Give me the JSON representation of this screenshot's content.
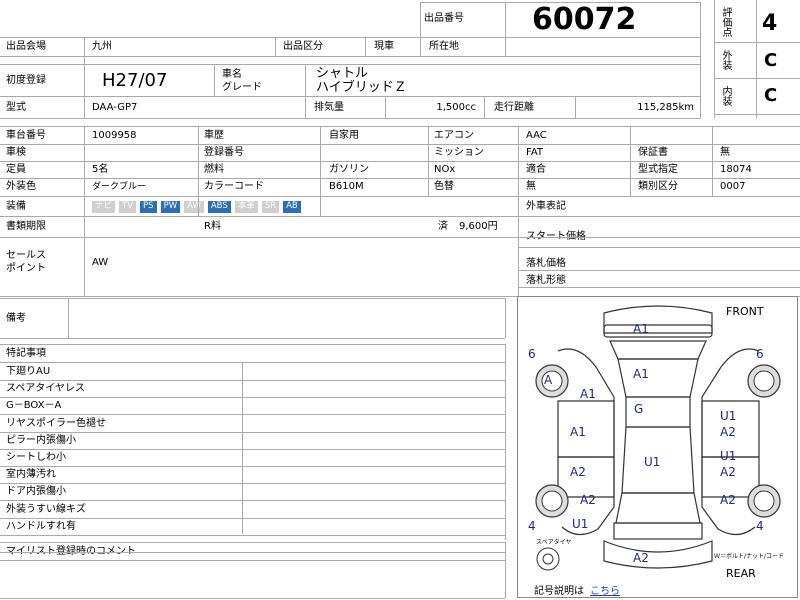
{
  "header": {
    "lot_label": "出品番号",
    "lot_number": "60072",
    "score_label": "評価点",
    "score_value": "4",
    "exterior_label": "外装",
    "exterior_value": "C",
    "interior_label": "内装",
    "interior_value": "C"
  },
  "row1": {
    "venue_label": "出品会場",
    "venue_value": "九州",
    "category_label": "出品区分",
    "category_value": "現車",
    "location_label": "所在地",
    "location_value": ""
  },
  "row2": {
    "first_reg_label": "初度登録",
    "first_reg_value": "H27/07",
    "model_name_label": "車名",
    "grade_label": "グレード",
    "model_name_value": "シャトル",
    "grade_value": "ハイブリッドＺ"
  },
  "row3": {
    "type_label": "型式",
    "type_value": "DAA-GP7",
    "displacement_label": "排気量",
    "displacement_value": "1,500cc",
    "mileage_label": "走行距離",
    "mileage_value": "115,285km"
  },
  "specs": {
    "chassis_label": "車台番号",
    "chassis_value": "1009958",
    "history_label": "車歴",
    "history_value": "自家用",
    "ac_label": "エアコン",
    "ac_value": "AAC",
    "inspection_label": "車検",
    "inspection_value": "",
    "regno_label": "登録番号",
    "regno_value": "",
    "mission_label": "ミッション",
    "mission_value": "FAT",
    "warranty_label": "保証書",
    "warranty_value": "無",
    "capacity_label": "定員",
    "capacity_value": "5名",
    "fuel_label": "燃料",
    "fuel_value": "ガソリン",
    "nox_label": "NOx",
    "nox_value": "適合",
    "type_code_label": "型式指定",
    "type_code_value": "18074",
    "color_label": "外装色",
    "color_value": "ダークブルー",
    "color_code_label": "カラーコード",
    "color_code_value": "B610M",
    "color_change_label": "色替",
    "color_change_value": "無",
    "class_code_label": "類別区分",
    "class_code_value": "0007",
    "equipment_label": "装備",
    "equipment": [
      {
        "label": "ナビ",
        "on": false
      },
      {
        "label": "TV",
        "on": false
      },
      {
        "label": "PS",
        "on": true
      },
      {
        "label": "PW",
        "on": true
      },
      {
        "label": "AW",
        "on": false
      },
      {
        "label": "ABS",
        "on": true
      },
      {
        "label": "本革",
        "on": false
      },
      {
        "label": "SR",
        "on": false
      },
      {
        "label": "AB",
        "on": true
      }
    ],
    "import_label": "外車表記",
    "import_value": "",
    "docs_label": "書類期限",
    "docs_value": "",
    "recycle_label": "R料",
    "recycle_status": "済",
    "recycle_value": "9,600円",
    "start_price_label": "スタート価格",
    "start_price_value": "",
    "sales_point_label_1": "セールス",
    "sales_point_label_2": "ポイント",
    "sales_point_value": "AW",
    "sold_price_label": "落札価格",
    "sold_price_value": "",
    "sold_form_label": "落札形態",
    "sold_form_value": ""
  },
  "remarks": {
    "label": "備考",
    "value": ""
  },
  "special": {
    "label": "特記事項",
    "items": [
      "下廻りAU",
      "スペアタイヤレス",
      "G－BOX－A",
      "リヤスポイラー色褪せ",
      "ピラー内張傷小",
      "シートしわ小",
      "室内薄汚れ",
      "ドア内張傷小",
      "外装うすい線キズ",
      "ハンドルすれ有"
    ],
    "comment_label": "マイリスト登録時のコメント",
    "comment_value": ""
  },
  "diagram": {
    "front": "FRONT",
    "rear": "REAR",
    "spare_note": "スペアタイヤ",
    "roof_note": "Ｗ＝ボルト/ナット/コード",
    "legend_label": "記号説明は",
    "legend_link": "こちら",
    "marks": {
      "hood": "A1",
      "windshield": "A1",
      "roof": "G",
      "cabin": "U1",
      "tire_fl": "6",
      "tire_fr": "6",
      "tire_rl": "4",
      "tire_rr": "4",
      "wheel_fl": "A",
      "fender_fl": "A1",
      "door_fl": "A1",
      "door_rl": "A2",
      "quarter_rl": "A2",
      "rocker_rl": "U1",
      "door_fr_1": "U1",
      "door_fr_2": "A2",
      "door_rr_1": "U1",
      "door_rr_2": "A2",
      "quarter_rr": "A2",
      "rear_bumper": "A2"
    }
  }
}
